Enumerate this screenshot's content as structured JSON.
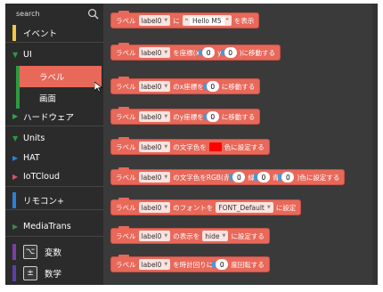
{
  "sidebar": {
    "search_placeholder": "search",
    "categories": [
      {
        "label": "イベント",
        "color": "#f0c846"
      },
      {
        "label": "UI",
        "color": "#2e9a3e"
      },
      {
        "label": "ハードウェア",
        "color": "#2aa84a"
      },
      {
        "label": "Units",
        "color": "#2e9a3e"
      },
      {
        "label": "HAT",
        "color": "#2c7fd6"
      },
      {
        "label": "IoTCloud",
        "color": "#d94f6a"
      },
      {
        "label": "リモコン+",
        "color": "#2c7fd6"
      },
      {
        "label": "MediaTrans",
        "color": "#3a8a4a"
      },
      {
        "label": "変数",
        "color": "#7a3fa8",
        "icon": "⌥"
      },
      {
        "label": "数学",
        "color": "#5d3fa8",
        "icon": "±"
      }
    ],
    "ui_sub": [
      {
        "label": "ラベル",
        "selected": true
      },
      {
        "label": "画面",
        "selected": false
      }
    ]
  },
  "blocks": {
    "common": {
      "prefix": "ラベル",
      "label_var": "label0"
    },
    "b1": {
      "t1": "に",
      "text": "Hello M5",
      "t2": "を表示"
    },
    "b2": {
      "t1": "を座標(x",
      "x": "0",
      "t2": "y",
      "y": "0",
      "t3": ")に移動する"
    },
    "b3": {
      "t1": "のx座標を",
      "n": "0",
      "t2": "に移動する"
    },
    "b4": {
      "t1": "のy座標を",
      "n": "0",
      "t2": "に移動する"
    },
    "b5": {
      "t1": "の文字色を",
      "t2": "色に設定する",
      "color": "#ff0000"
    },
    "b6": {
      "t1": "の文字色をRGB(赤",
      "r": "0",
      "t2": "緑",
      "g": "0",
      "t3": "青",
      "b": "0",
      "t4": ")色に設定する"
    },
    "b7": {
      "t1": "のフォントを",
      "font": "FONT_Default",
      "t2": "に設定"
    },
    "b8": {
      "t1": "の表示を",
      "vis": "hide",
      "t2": "に設定する"
    },
    "b9": {
      "t1": "を時計回りに",
      "n": "0",
      "t2": "度回転する"
    }
  }
}
